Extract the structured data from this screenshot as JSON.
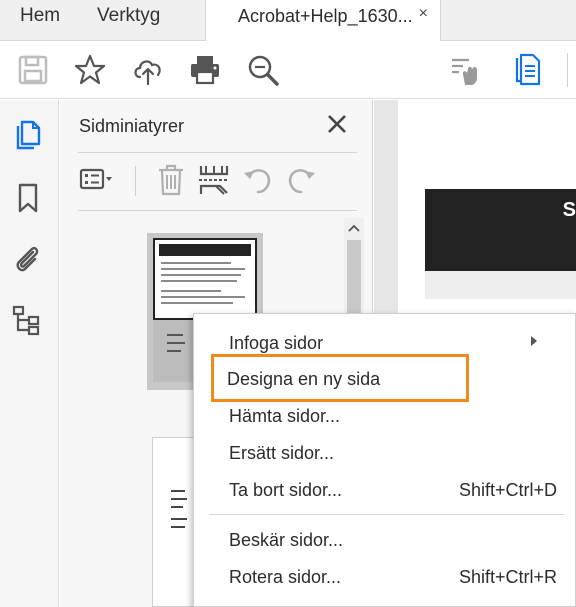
{
  "menubar": {
    "items": [
      {
        "label": "Hem"
      },
      {
        "label": "Verktyg"
      }
    ],
    "active_doc_tab": {
      "title": "Acrobat+Help_1630...",
      "close_glyph": "×"
    }
  },
  "toolbar": {
    "icons": [
      "save-icon",
      "bookmark-star-icon",
      "cloud-upload-icon",
      "print-icon",
      "zoom-search-icon",
      "pointer-hand-icon",
      "page-thumbnails-icon"
    ]
  },
  "rail": {
    "icons": [
      "page-thumbnails-icon",
      "bookmark-icon",
      "attachment-icon",
      "content-tree-icon"
    ],
    "active": "page-thumbnails-icon",
    "accent_color": "#1473e6"
  },
  "panel": {
    "title": "Sidminiatyrer",
    "close_glyph": "✕",
    "tools": [
      "thumbnail-options-icon",
      "delete-page-icon",
      "insert-page-icon",
      "rotate-left-icon",
      "rotate-right-icon"
    ]
  },
  "context_menu": {
    "items": [
      {
        "label": "Infoga sidor",
        "shortcut": "",
        "has_submenu": true
      },
      {
        "label": "Designa en ny sida",
        "shortcut": "",
        "highlighted": true
      },
      {
        "label": "Hämta sidor...",
        "shortcut": ""
      },
      {
        "label": "Ersätt sidor...",
        "shortcut": ""
      },
      {
        "label": "Ta bort sidor...",
        "shortcut": "Shift+Ctrl+D"
      },
      {
        "label": "Beskär sidor...",
        "shortcut": ""
      },
      {
        "label": "Rotera sidor...",
        "shortcut": "Shift+Ctrl+R"
      }
    ],
    "highlight_color": "#f18a1b"
  },
  "document": {
    "banner_letter": "S"
  }
}
